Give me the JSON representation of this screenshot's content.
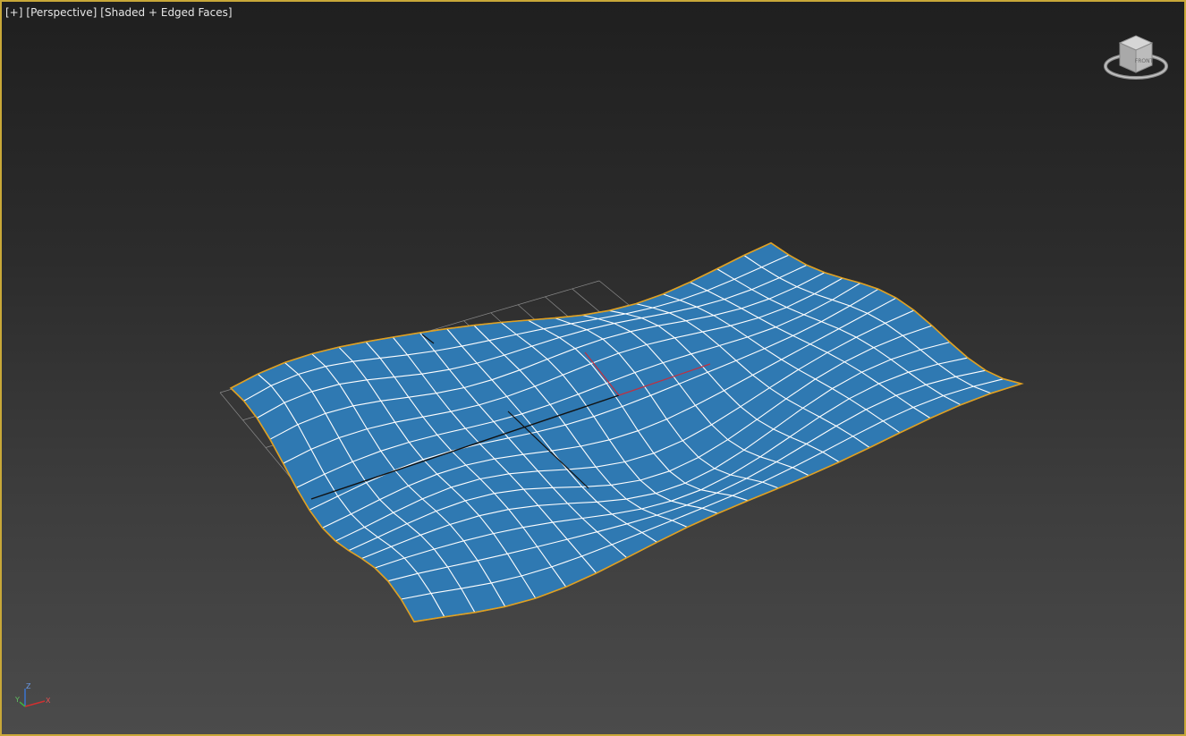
{
  "viewport": {
    "label_plus": "[+]",
    "label_view": "[Perspective]",
    "label_shading": "[Shaded + Edged Faces]"
  },
  "viewcube": {
    "face_label": "FRONT",
    "icon": "viewcube-icon"
  },
  "axis_tripod": {
    "x": "X",
    "y": "Y",
    "z": "Z",
    "icon": "axis-tripod-icon"
  },
  "colors": {
    "viewport_border": "#c8a838",
    "surface_fill": "#2f79b2",
    "surface_edges": "#ffffff",
    "selection_outline": "#e0a020",
    "home_grid": "#8a8a8a"
  }
}
